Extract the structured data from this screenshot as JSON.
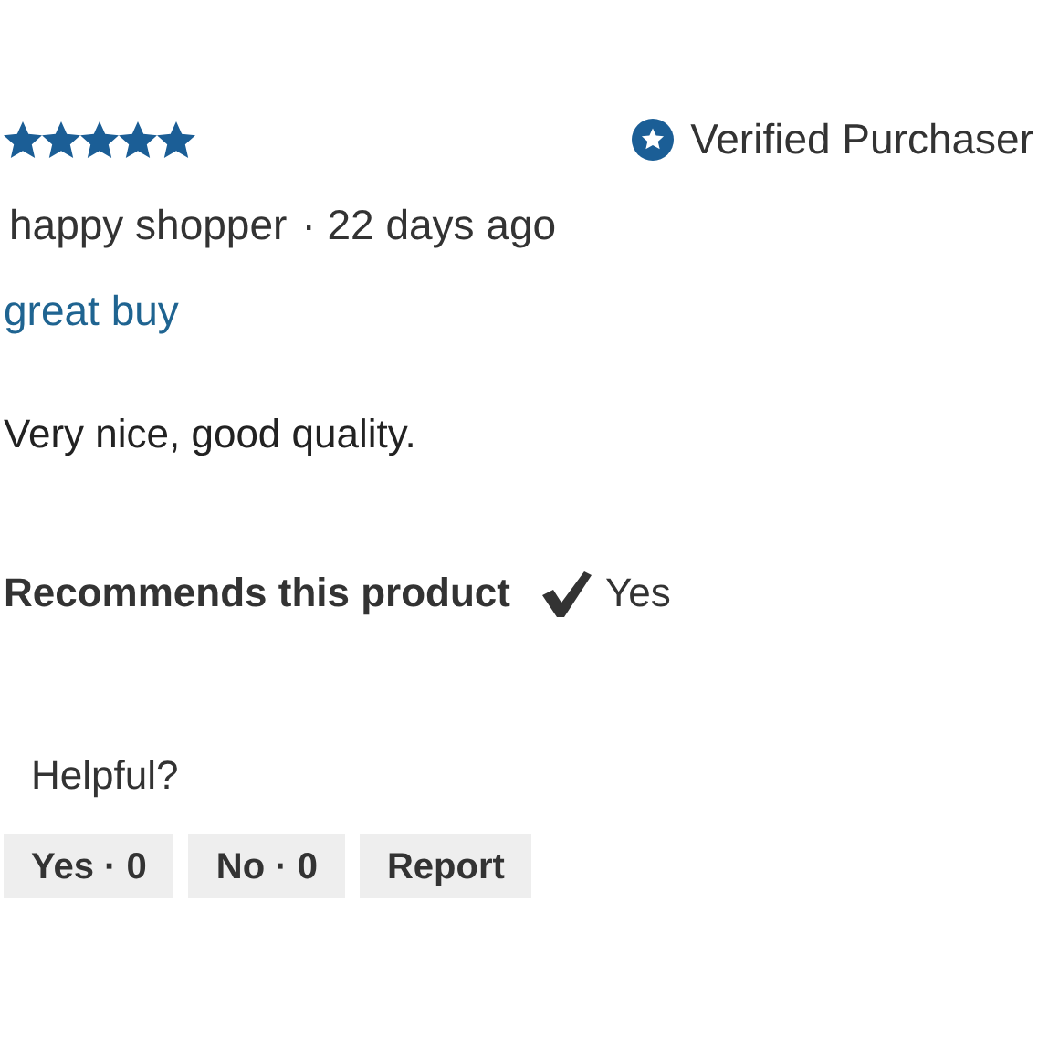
{
  "review": {
    "stars": 5,
    "verified": true,
    "verified_label": "Verified Purchaser",
    "author": "happy shopper",
    "age": "· 22 days ago",
    "title": "great buy",
    "body": "Very nice, good quality.",
    "recommendation": {
      "label": "Recommends this product",
      "recommended": true,
      "value": "Yes"
    }
  },
  "feedback": {
    "prompt": "Helpful?",
    "buttons": [
      {
        "label": "Yes · 0"
      },
      {
        "label": "No · 0"
      },
      {
        "label": "Report"
      }
    ]
  }
}
